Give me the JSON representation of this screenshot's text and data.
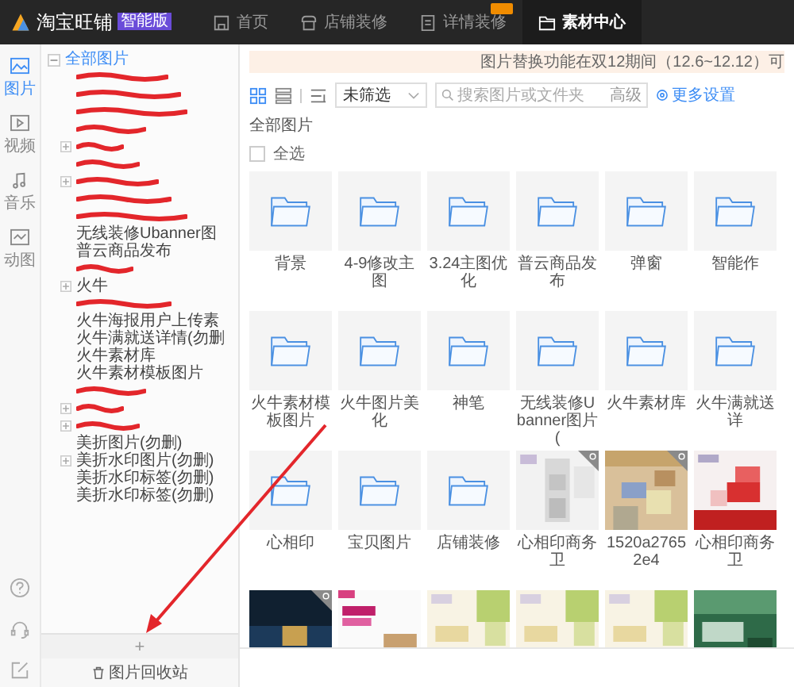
{
  "brand": {
    "name": "淘宝旺铺",
    "badge": "智能版"
  },
  "nav": [
    {
      "label": "首页",
      "kind": "home",
      "selected": false,
      "flag": false
    },
    {
      "label": "店铺装修",
      "kind": "shop",
      "selected": false,
      "flag": false
    },
    {
      "label": "详情装修",
      "kind": "doc",
      "selected": false,
      "flag": true
    },
    {
      "label": "素材中心",
      "kind": "folder",
      "selected": true,
      "flag": false
    }
  ],
  "rail": [
    {
      "label": "图片",
      "kind": "picture",
      "selected": true
    },
    {
      "label": "视频",
      "kind": "video",
      "selected": false
    },
    {
      "label": "音乐",
      "kind": "music",
      "selected": false
    },
    {
      "label": "动图",
      "kind": "gif",
      "selected": false
    }
  ],
  "rail_tools": [
    {
      "kind": "help"
    },
    {
      "kind": "headset"
    },
    {
      "kind": "edit"
    }
  ],
  "tree": {
    "label": "全部图片",
    "selected": true,
    "expanded": true,
    "children": [
      {
        "kind": "item",
        "redacted": true
      },
      {
        "kind": "item",
        "redacted": true
      },
      {
        "kind": "item",
        "redacted": true
      },
      {
        "kind": "item",
        "redacted": true
      },
      {
        "kind": "group",
        "redacted": true
      },
      {
        "kind": "item",
        "redacted": true
      },
      {
        "kind": "group",
        "redacted": true
      },
      {
        "kind": "item",
        "redacted": true
      },
      {
        "kind": "item",
        "redacted": true
      },
      {
        "kind": "item",
        "redacted": false,
        "label": "无线装修Ubanner图"
      },
      {
        "kind": "item",
        "redacted": false,
        "label": "普云商品发布"
      },
      {
        "kind": "item",
        "redacted": true
      },
      {
        "kind": "group",
        "redacted": false,
        "label": "火牛"
      },
      {
        "kind": "item",
        "redacted": true
      },
      {
        "kind": "item",
        "redacted": false,
        "label": "火牛海报用户上传素"
      },
      {
        "kind": "item",
        "redacted": false,
        "label": "火牛满就送详情(勿删"
      },
      {
        "kind": "item",
        "redacted": false,
        "label": "火牛素材库"
      },
      {
        "kind": "item",
        "redacted": false,
        "label": "火牛素材模板图片"
      },
      {
        "kind": "item",
        "redacted": true
      },
      {
        "kind": "group",
        "redacted": true
      },
      {
        "kind": "group",
        "redacted": true
      },
      {
        "kind": "item",
        "redacted": false,
        "label": "美折图片(勿删)"
      },
      {
        "kind": "group",
        "redacted": false,
        "label": "美折水印图片(勿删)"
      },
      {
        "kind": "item",
        "redacted": false,
        "label": "美折水印标签(勿删)"
      },
      {
        "kind": "item",
        "redacted": false,
        "label": "美折水印标签(勿删)"
      }
    ]
  },
  "tree_footer": {
    "add": "+",
    "recycle": "图片回收站"
  },
  "notice": "图片替换功能在双12期间（12.6~12.12）可",
  "toolbar": {
    "view_modes": [
      {
        "kind": "grid",
        "selected": true
      },
      {
        "kind": "list",
        "selected": false
      }
    ],
    "filter": "未筛选",
    "search_placeholder": "搜索图片或文件夹",
    "advanced": "高级",
    "settings": "更多设置"
  },
  "breadcrumb": "全部图片",
  "select_all": {
    "label": "全选",
    "checked": false
  },
  "tiles": [
    {
      "kind": "folder",
      "label": "背景"
    },
    {
      "kind": "folder",
      "label": "4-9修改主图"
    },
    {
      "kind": "folder",
      "label": "3.24主图优化"
    },
    {
      "kind": "folder",
      "label": "普云商品发布"
    },
    {
      "kind": "folder",
      "label": "弹窗"
    },
    {
      "kind": "folder",
      "label": "智能作"
    },
    {
      "kind": "folder",
      "label": "火牛素材模板图片"
    },
    {
      "kind": "folder",
      "label": "火牛图片美化"
    },
    {
      "kind": "folder",
      "label": "神笔"
    },
    {
      "kind": "folder",
      "label": "无线装修Ubanner图片("
    },
    {
      "kind": "folder",
      "label": "火牛素材库"
    },
    {
      "kind": "folder",
      "label": "火牛满就送详"
    },
    {
      "kind": "folder",
      "label": "心相印"
    },
    {
      "kind": "folder",
      "label": "宝贝图片"
    },
    {
      "kind": "folder",
      "label": "店铺装修"
    },
    {
      "kind": "picture",
      "label": "心相印商务卫",
      "corner_mark": true
    },
    {
      "kind": "picture",
      "label": "1520a27652e4",
      "corner_mark": true
    },
    {
      "kind": "picture",
      "label": "心相印商务卫",
      "corner_mark": false
    },
    {
      "kind": "picture",
      "corner_mark": true
    },
    {
      "kind": "picture",
      "corner_mark": false
    },
    {
      "kind": "picture",
      "corner_mark": false
    },
    {
      "kind": "picture",
      "corner_mark": false
    },
    {
      "kind": "picture",
      "corner_mark": false
    },
    {
      "kind": "picture",
      "corner_mark": false
    }
  ],
  "annotation_arrow": true
}
